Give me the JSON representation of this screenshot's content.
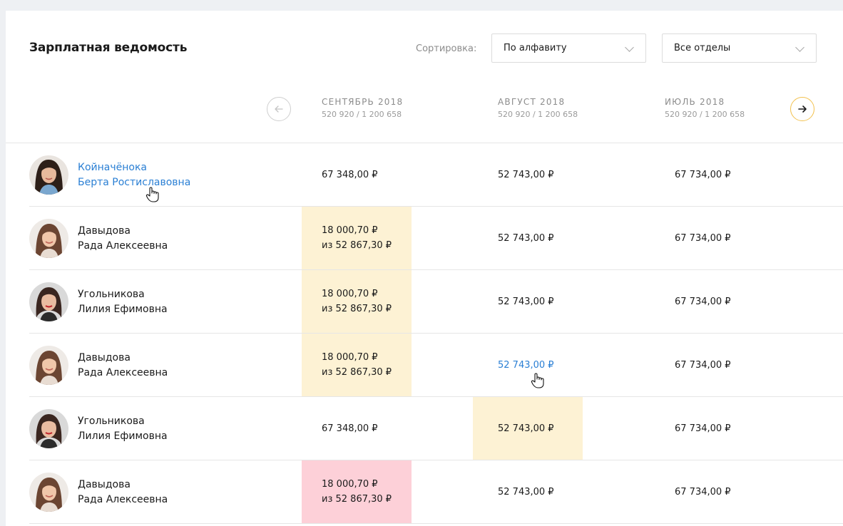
{
  "header": {
    "title": "Зарплатная ведомость",
    "sort_label": "Сортировка:",
    "sort_value": "По алфавиту",
    "dept_value": "Все отделы"
  },
  "months": [
    {
      "name": "СЕНТЯБРЬ 2018",
      "total": "520 920 / 1 200 658"
    },
    {
      "name": "АВГУСТ 2018",
      "total": "520 920 / 1 200 658"
    },
    {
      "name": "ИЮЛЬ 2018",
      "total": "520 920 / 1 200 658"
    }
  ],
  "icons": {
    "prev": "arrow-left-icon",
    "next": "arrow-right-icon"
  },
  "colors": {
    "link": "#2a7fd4",
    "highlight_yellow": "#fdf2d4",
    "highlight_red": "#fdd0d8",
    "next_button_border": "#f2c14e"
  },
  "rows": [
    {
      "last_name": "Койначёнока",
      "first_middle": "Берта Ростиславовна",
      "cells": [
        {
          "line1": "67 348,00 ₽",
          "line2": ""
        },
        {
          "line1": "52 743,00 ₽",
          "line2": ""
        },
        {
          "line1": "67 734,00 ₽",
          "line2": ""
        }
      ]
    },
    {
      "last_name": "Давыдова",
      "first_middle": "Рада Алексеевна",
      "cells": [
        {
          "line1": "18 000,70 ₽",
          "line2": "из 52 867,30 ₽"
        },
        {
          "line1": "52 743,00 ₽",
          "line2": ""
        },
        {
          "line1": "67 734,00 ₽",
          "line2": ""
        }
      ]
    },
    {
      "last_name": "Угольникова",
      "first_middle": "Лилия Ефимовна",
      "cells": [
        {
          "line1": "18 000,70 ₽",
          "line2": "из 52 867,30 ₽"
        },
        {
          "line1": "52 743,00 ₽",
          "line2": ""
        },
        {
          "line1": "67 734,00 ₽",
          "line2": ""
        }
      ]
    },
    {
      "last_name": "Давыдова",
      "first_middle": "Рада Алексеевна",
      "cells": [
        {
          "line1": "18 000,70 ₽",
          "line2": "из 52 867,30 ₽"
        },
        {
          "line1": "52 743,00 ₽",
          "line2": ""
        },
        {
          "line1": "67 734,00 ₽",
          "line2": ""
        }
      ]
    },
    {
      "last_name": "Угольникова",
      "first_middle": "Лилия Ефимовна",
      "cells": [
        {
          "line1": "67 348,00 ₽",
          "line2": ""
        },
        {
          "line1": "52 743,00 ₽",
          "line2": ""
        },
        {
          "line1": "67 734,00 ₽",
          "line2": ""
        }
      ]
    },
    {
      "last_name": "Давыдова",
      "first_middle": "Рада Алексеевна",
      "cells": [
        {
          "line1": "18 000,70 ₽",
          "line2": "из 52 867,30 ₽"
        },
        {
          "line1": "52 743,00 ₽",
          "line2": ""
        },
        {
          "line1": "67 734,00 ₽",
          "line2": ""
        }
      ]
    }
  ]
}
